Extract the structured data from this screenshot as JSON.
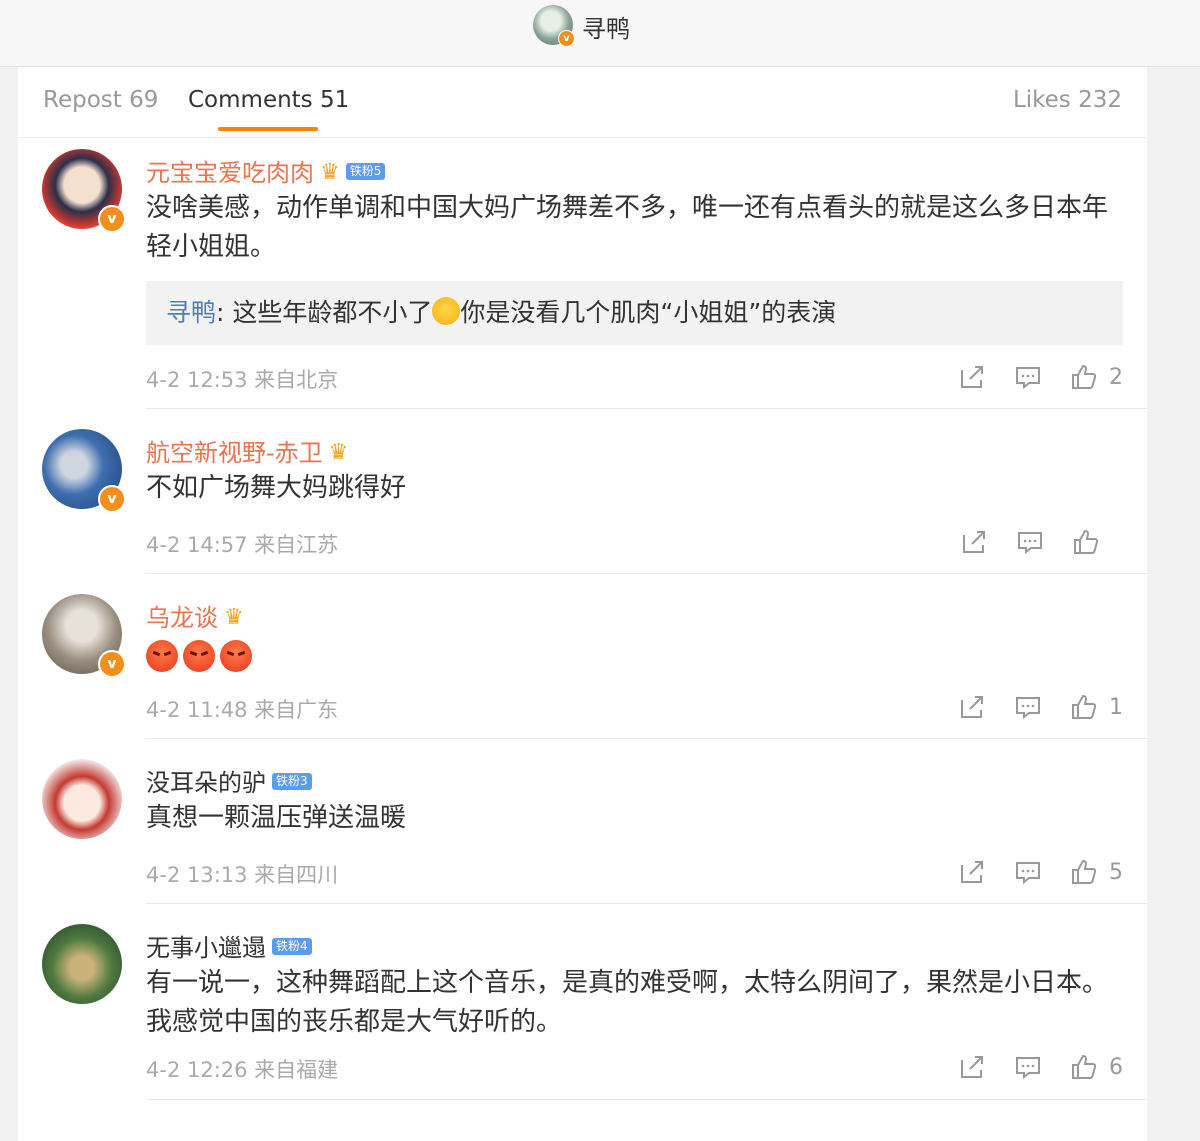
{
  "header": {
    "title": "寻鸭"
  },
  "tabs": {
    "repost": "Repost 69",
    "comments": "Comments 51",
    "likes": "Likes 232"
  },
  "colors": {
    "accent": "#ff8200",
    "username": "#eb7350",
    "reply_name": "#4e7cb8"
  },
  "comments": [
    {
      "name": "元宝宝爱吃肉肉",
      "badge": "铁粉5",
      "text": "没啥美感，动作单调和中国大妈广场舞差不多，唯一还有点看头的就是这么多日本年轻小姐姐。",
      "reply": {
        "name": "寻鸭",
        "text_before": ": 这些年龄都不小了",
        "text_after": "你是没看几个肌肉“小姐姐”的表演"
      },
      "time": "4-2 12:53 来自北京",
      "likes": "2"
    },
    {
      "name": "航空新视野-赤卫",
      "text": "不如广场舞大妈跳得好",
      "time": "4-2 14:57 来自江苏",
      "likes": ""
    },
    {
      "name": "乌龙谈",
      "text": "",
      "time": "4-2 11:48 来自广东",
      "likes": "1"
    },
    {
      "name": "没耳朵的驴",
      "badge": "铁粉3",
      "text": "真想一颗温压弹送温暖",
      "time": "4-2 13:13 来自四川",
      "likes": "5"
    },
    {
      "name": "无事小邋遢",
      "badge": "铁粉4",
      "text": "有一说一，这种舞蹈配上这个音乐，是真的难受啊，太特么阴间了，果然是小日本。我感觉中国的丧乐都是大气好听的。",
      "time": "4-2 12:26 来自福建",
      "likes": "6"
    }
  ]
}
